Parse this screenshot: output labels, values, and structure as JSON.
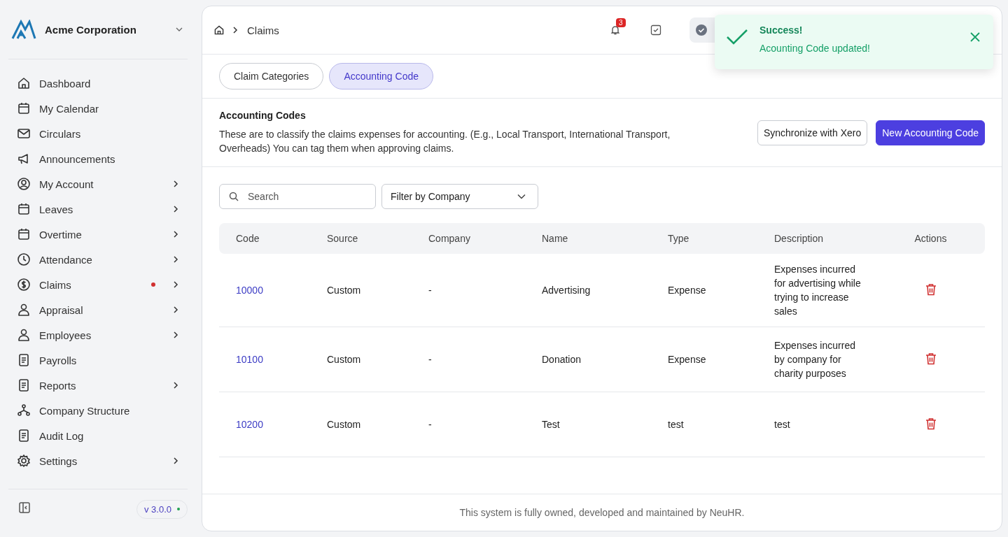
{
  "sidebar": {
    "company": "Acme Corporation",
    "items": [
      {
        "label": "Dashboard",
        "has_submenu": false,
        "alert": false
      },
      {
        "label": "My Calendar",
        "has_submenu": false,
        "alert": false
      },
      {
        "label": "Circulars",
        "has_submenu": false,
        "alert": false
      },
      {
        "label": "Announcements",
        "has_submenu": false,
        "alert": false
      },
      {
        "label": "My Account",
        "has_submenu": true,
        "alert": false
      },
      {
        "label": "Leaves",
        "has_submenu": true,
        "alert": false
      },
      {
        "label": "Overtime",
        "has_submenu": true,
        "alert": false
      },
      {
        "label": "Attendance",
        "has_submenu": true,
        "alert": false
      },
      {
        "label": "Claims",
        "has_submenu": true,
        "alert": true
      },
      {
        "label": "Appraisal",
        "has_submenu": true,
        "alert": false
      },
      {
        "label": "Employees",
        "has_submenu": true,
        "alert": false
      },
      {
        "label": "Payrolls",
        "has_submenu": false,
        "alert": false
      },
      {
        "label": "Reports",
        "has_submenu": true,
        "alert": false
      },
      {
        "label": "Company Structure",
        "has_submenu": false,
        "alert": false
      },
      {
        "label": "Audit Log",
        "has_submenu": false,
        "alert": false
      },
      {
        "label": "Settings",
        "has_submenu": true,
        "alert": false
      }
    ],
    "version": "v 3.0.0"
  },
  "breadcrumb": [
    "Claims"
  ],
  "notifications": {
    "count": "3"
  },
  "tabs": [
    {
      "label": "Claim Categories",
      "selected": false
    },
    {
      "label": "Accounting Code",
      "selected": true
    }
  ],
  "section": {
    "title": "Accounting Codes",
    "description": "These are to classify the claims expenses for accounting. (E.g., Local Transport, International Transport, Overheads) You can tag them when approving claims.",
    "buttons": [
      {
        "label": "Synchronize with Xero",
        "kind": "secondary"
      },
      {
        "label": "New Accounting Code",
        "kind": "primary"
      }
    ]
  },
  "search": {
    "placeholder": "Search"
  },
  "filter": {
    "value": "Filter by Company"
  },
  "table": {
    "columns": [
      "Code",
      "Source",
      "Company",
      "Name",
      "Type",
      "Description",
      "Actions"
    ],
    "rows": [
      {
        "code": "10000",
        "source": "Custom",
        "company": "-",
        "name": "Advertising",
        "type": "Expense",
        "description": "Expenses incurred for advertising while trying to increase sales"
      },
      {
        "code": "10100",
        "source": "Custom",
        "company": "-",
        "name": "Donation",
        "type": "Expense",
        "description": "Expenses incurred by company for charity purposes"
      },
      {
        "code": "10200",
        "source": "Custom",
        "company": "-",
        "name": "Test",
        "type": "test",
        "description": "test"
      }
    ]
  },
  "footer": "This system is fully owned, developed and maintained by NeuHR.",
  "toast": {
    "title": "Success!",
    "message": "Acounting Code updated!"
  }
}
